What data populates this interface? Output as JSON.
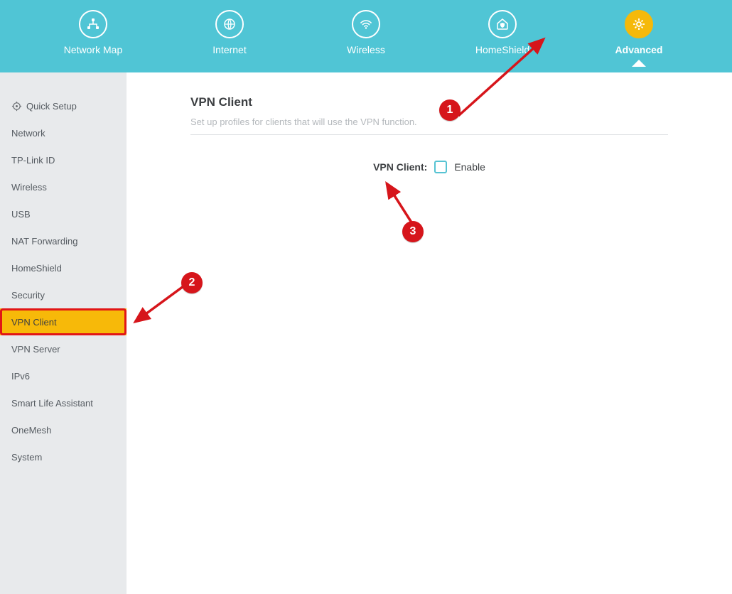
{
  "nav": {
    "items": [
      {
        "label": "Network Map",
        "active": false
      },
      {
        "label": "Internet",
        "active": false
      },
      {
        "label": "Wireless",
        "active": false
      },
      {
        "label": "HomeShield",
        "active": false
      },
      {
        "label": "Advanced",
        "active": true
      }
    ]
  },
  "sidebar": {
    "items": [
      {
        "label": "Quick Setup",
        "selected": false,
        "has_icon": true
      },
      {
        "label": "Network",
        "selected": false
      },
      {
        "label": "TP-Link ID",
        "selected": false
      },
      {
        "label": "Wireless",
        "selected": false
      },
      {
        "label": "USB",
        "selected": false
      },
      {
        "label": "NAT Forwarding",
        "selected": false
      },
      {
        "label": "HomeShield",
        "selected": false
      },
      {
        "label": "Security",
        "selected": false
      },
      {
        "label": "VPN Client",
        "selected": true
      },
      {
        "label": "VPN Server",
        "selected": false
      },
      {
        "label": "IPv6",
        "selected": false
      },
      {
        "label": "Smart Life Assistant",
        "selected": false
      },
      {
        "label": "OneMesh",
        "selected": false
      },
      {
        "label": "System",
        "selected": false
      }
    ]
  },
  "main": {
    "title": "VPN Client",
    "description": "Set up profiles for clients that will use the VPN function.",
    "field_label": "VPN Client:",
    "enable_label": "Enable",
    "enabled": false
  },
  "annotations": {
    "b1": "1",
    "b2": "2",
    "b3": "3"
  },
  "colors": {
    "topbar": "#50c5d5",
    "accent": "#f5b90a",
    "annotation": "#d6151b",
    "sidebar": "#e8eaec"
  }
}
